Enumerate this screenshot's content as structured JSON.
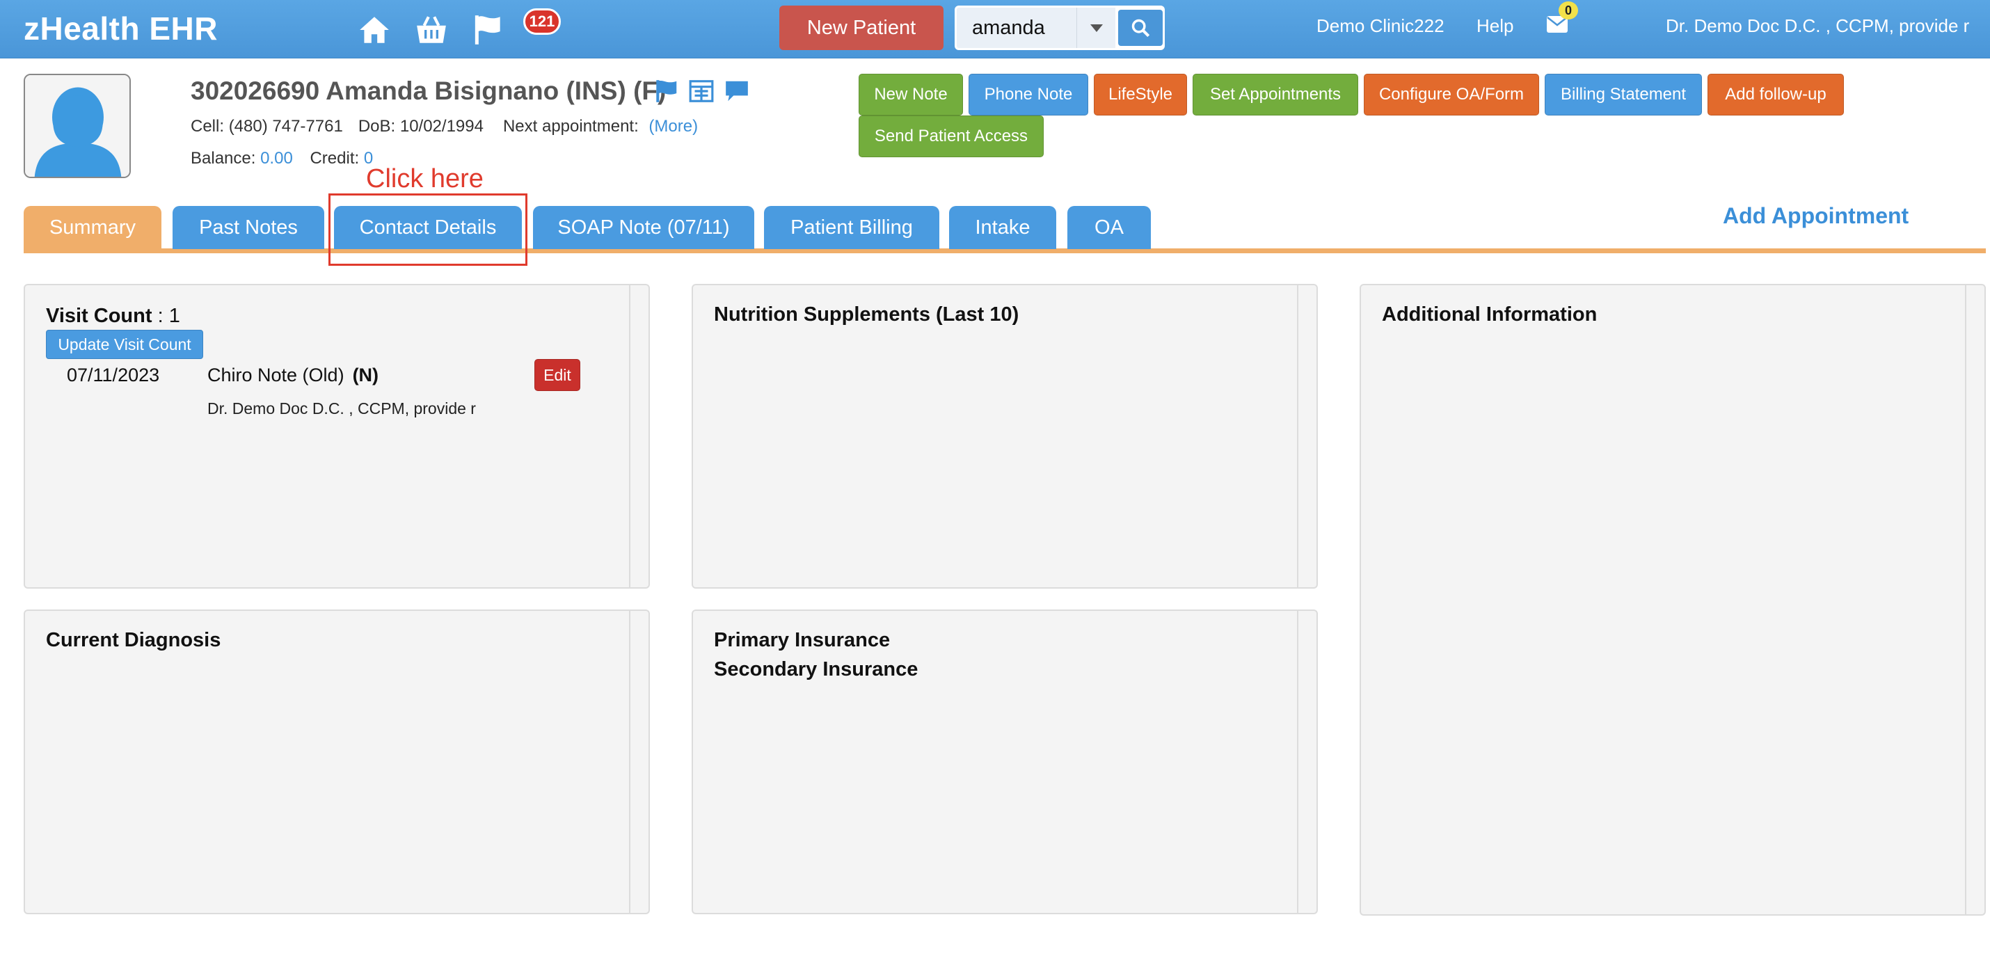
{
  "app": {
    "brand": "zHealth EHR",
    "notif_count": "121"
  },
  "topbar": {
    "new_patient_label": "New Patient",
    "search_value": "amanda",
    "clinic": "Demo Clinic222",
    "help": "Help",
    "mail_count": "0",
    "user": "Dr. Demo Doc D.C. , CCPM, provide r"
  },
  "patient": {
    "name_line": "302026690 Amanda Bisignano  (INS) (F)",
    "cell_label": "Cell:",
    "cell": "(480) 747-7761",
    "dob_label": "DoB:",
    "dob": "10/02/1994",
    "next_appt_label": "Next appointment:",
    "next_appt_more": "(More)",
    "balance_label": "Balance:",
    "balance": "0.00",
    "credit_label": "Credit:",
    "credit": "0"
  },
  "actions": {
    "new_note": "New Note",
    "phone_note": "Phone Note",
    "lifestyle": "LifeStyle",
    "set_appointments": "Set Appointments",
    "configure_oa": "Configure OA/Form",
    "billing_statement": "Billing Statement",
    "add_followup": "Add follow-up",
    "send_access": "Send Patient Access"
  },
  "tabs": [
    {
      "label": "Summary"
    },
    {
      "label": "Past Notes"
    },
    {
      "label": "Contact Details"
    },
    {
      "label": "SOAP Note (07/11)"
    },
    {
      "label": "Patient Billing"
    },
    {
      "label": "Intake"
    },
    {
      "label": "OA"
    }
  ],
  "annotation": {
    "text": "Click here"
  },
  "add_appointment": "Add Appointment",
  "visits": {
    "count_label": "Visit Count",
    "count_sep": " : ",
    "count": "1",
    "update_label": "Update Visit Count",
    "note": {
      "date": "07/11/2023",
      "type": "Chiro Note (Old)",
      "flag": "(N)",
      "edit_label": "Edit",
      "provider": "Dr. Demo Doc D.C. , CCPM, provide r"
    }
  },
  "panels": {
    "nutrition_title": "Nutrition Supplements (Last 10)",
    "additional_title": "Additional Information",
    "diagnosis_title": "Current Diagnosis",
    "primary_insurance": "Primary Insurance",
    "secondary_insurance": "Secondary Insurance"
  },
  "colors": {
    "topbar": "#4a96d8",
    "tab_active": "#f0ae6a",
    "tab_default": "#4a9be0",
    "btn_green": "#73ad3d",
    "btn_orange": "#e26a2c",
    "btn_danger": "#c9302c",
    "annotation": "#e03b2d"
  }
}
